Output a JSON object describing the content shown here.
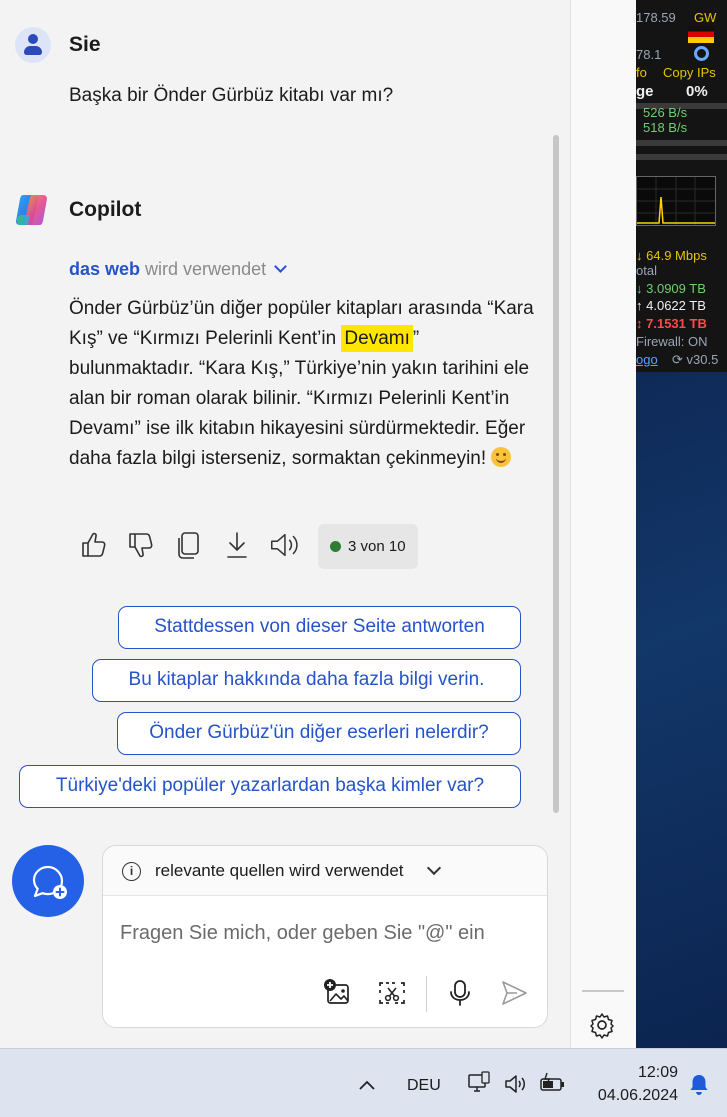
{
  "user": {
    "name": "Sie",
    "message": "Başka bir Önder Gürbüz kitabı var mı?"
  },
  "assistant": {
    "name": "Copilot",
    "source": {
      "label": "das web",
      "suffix": "wird verwendet"
    },
    "answer": {
      "part1": "Önder Gürbüz’ün diğer popüler kitapları arasında “Kara Kış” ve “Kırmızı Pelerinli Kent’in ",
      "highlight": "Devamı",
      "part2": "” bulunmaktadır. “Kara Kış,” Türkiye’nin yakın tarihini ele alan bir roman olarak bilinir. “Kırmızı Pelerinli Kent’in Devamı” ise ilk kitabın hikayesini sürdürmektedir. Eğer daha fazla bilgi isterseniz, sormaktan çekinmeyin! "
    },
    "counter": "3 von 10"
  },
  "suggestions": [
    "Stattdessen von dieser Seite antworten",
    "Bu kitaplar hakkında daha fazla bilgi verin.",
    "Önder Gürbüz'ün diğer eserleri nelerdir?",
    "Türkiye'deki popüler yazarlardan başka kimler var?"
  ],
  "composer": {
    "mode_label": "relevante quellen wird verwendet",
    "placeholder": "Fragen Sie mich, oder geben Sie \"@\" ein"
  },
  "widget": {
    "r1a": "178.59",
    "r1b": "GW",
    "r2a": "78.1",
    "r3a": "fo",
    "r3b": "Copy IPs",
    "r4a": "ge",
    "r4b": "0%",
    "down_rate": "526 B/s",
    "up_rate": "518 B/s",
    "speed": "64.9 Mbps",
    "total_label": "otal",
    "total_down": "3.0909 TB",
    "total_up": "4.0622 TB",
    "total_sum": "7.1531 TB",
    "firewall": "Firewall: ON",
    "logo_text": "ogo",
    "version": "v30.5"
  },
  "taskbar": {
    "language": "DEU",
    "time": "12:09",
    "date": "04.06.2024"
  },
  "colors": {
    "accent": "#2553c9",
    "highlight": "#ffe600",
    "fab": "#2461e6"
  }
}
